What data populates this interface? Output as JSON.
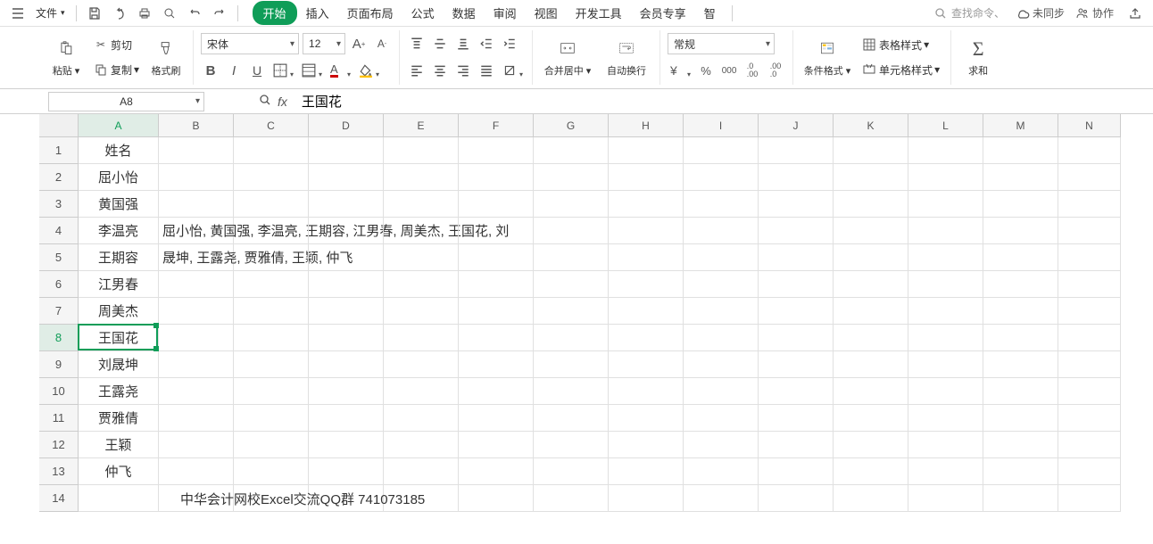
{
  "topMenu": {
    "file": "文件",
    "tabs": [
      "开始",
      "插入",
      "页面布局",
      "公式",
      "数据",
      "审阅",
      "视图",
      "开发工具",
      "会员专享"
    ],
    "truncated": "智",
    "searchPlaceholder": "查找命令、",
    "unsync": "未同步",
    "collab": "协作"
  },
  "ribbon": {
    "paste": "粘贴",
    "cut": "剪切",
    "copy": "复制",
    "formatPainter": "格式刷",
    "fontName": "宋体",
    "fontSize": "12",
    "mergeCenter": "合并居中",
    "autoWrap": "自动换行",
    "numberFormat": "常规",
    "condFormat": "条件格式",
    "tableStyle": "表格样式",
    "cellStyle": "单元格样式",
    "sum": "求和"
  },
  "formula": {
    "cellRef": "A8",
    "value": "王国花"
  },
  "sheet": {
    "colWidths": {
      "A": 90,
      "B": 84,
      "C": 84,
      "D": 84,
      "E": 84,
      "F": 84,
      "G": 84,
      "H": 84,
      "I": 84,
      "J": 84,
      "K": 84,
      "L": 84,
      "M": 84,
      "N": 70
    },
    "columns": [
      "A",
      "B",
      "C",
      "D",
      "E",
      "F",
      "G",
      "H",
      "I",
      "J",
      "K",
      "L",
      "M",
      "N"
    ],
    "selectedCol": "A",
    "selectedRow": 8,
    "rows": [
      {
        "n": 1,
        "A": "姓名"
      },
      {
        "n": 2,
        "A": "屈小怡"
      },
      {
        "n": 3,
        "A": "黄国强"
      },
      {
        "n": 4,
        "A": "李温亮",
        "B": "屈小怡, 黄国强, 李温亮, 王期容, 江男春, 周美杰, 王国花, 刘"
      },
      {
        "n": 5,
        "A": "王期容",
        "B": "晟坤, 王露尧, 贾雅倩, 王颖, 仲飞"
      },
      {
        "n": 6,
        "A": "江男春"
      },
      {
        "n": 7,
        "A": "周美杰"
      },
      {
        "n": 8,
        "A": "王国花"
      },
      {
        "n": 9,
        "A": "刘晟坤"
      },
      {
        "n": 10,
        "A": "王露尧"
      },
      {
        "n": 11,
        "A": "贾雅倩"
      },
      {
        "n": 12,
        "A": "王颖"
      },
      {
        "n": 13,
        "A": "仲飞"
      },
      {
        "n": 14,
        "A": "",
        "footer": "中华会计网校Excel交流QQ群  741073185"
      }
    ]
  }
}
